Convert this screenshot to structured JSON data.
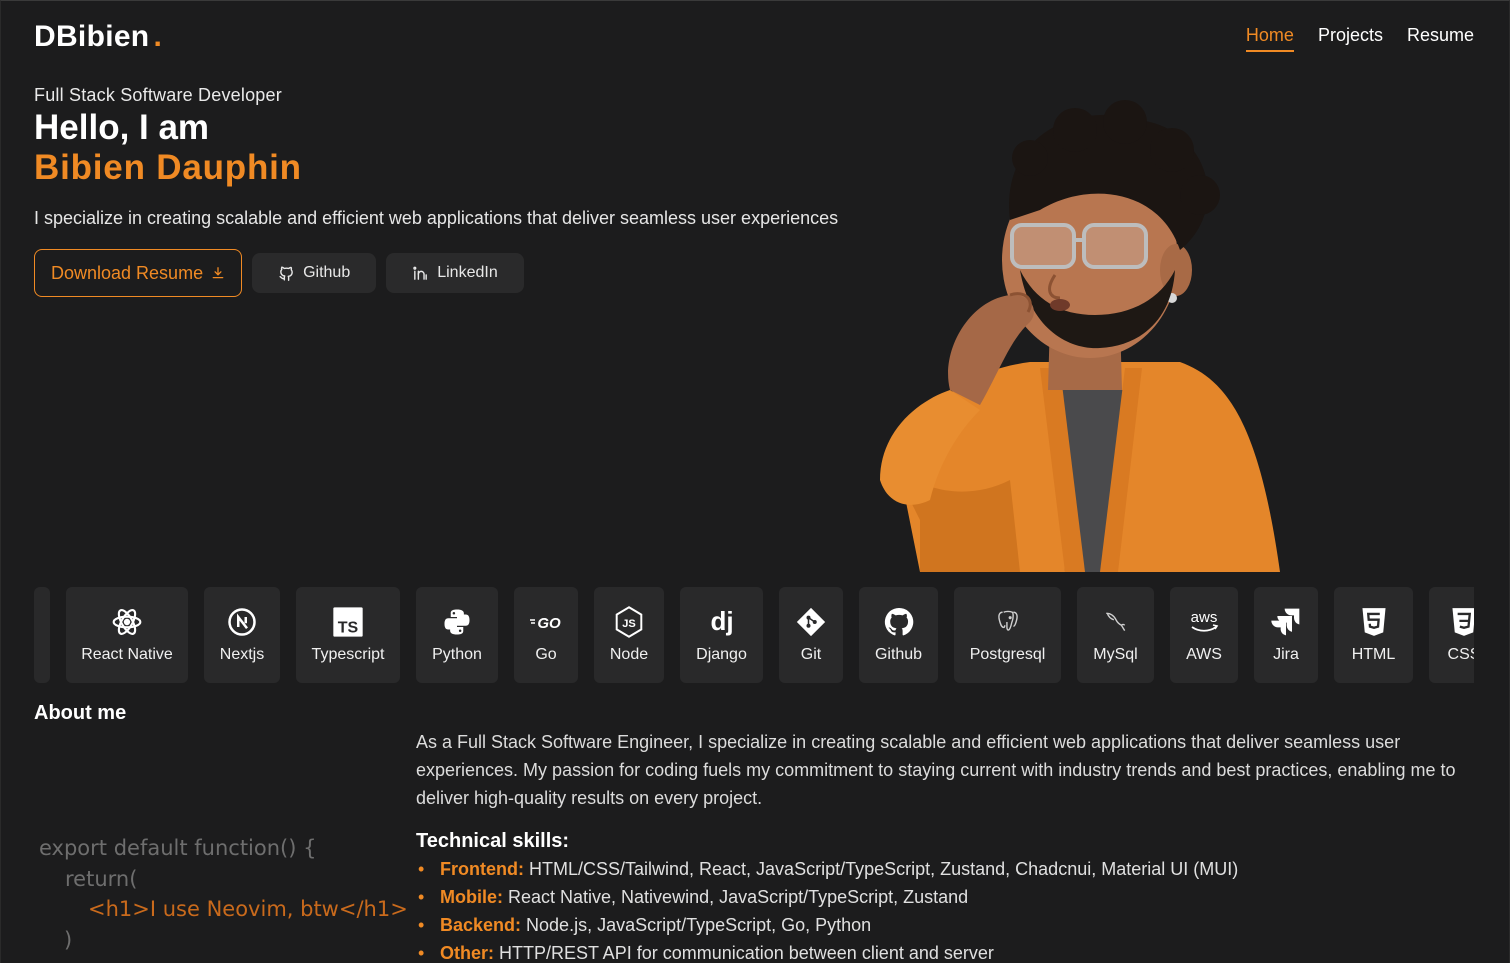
{
  "brand": {
    "name": "DBibien",
    "dot": ".",
    "accent_color": "#f08a24"
  },
  "nav": {
    "items": [
      {
        "label": "Home",
        "active": true
      },
      {
        "label": "Projects",
        "active": false
      },
      {
        "label": "Resume",
        "active": false
      }
    ]
  },
  "hero": {
    "role": "Full Stack Software Developer",
    "greeting": "Hello, I am",
    "name": "Bibien Dauphin",
    "tagline": "I specialize in creating scalable and efficient web applications that deliver seamless user experiences",
    "buttons": {
      "resume": "Download Resume",
      "github": "Github",
      "linkedin": "LinkedIn"
    }
  },
  "skills": [
    {
      "label": "React Native",
      "icon": "react-icon"
    },
    {
      "label": "Nextjs",
      "icon": "nextjs-icon"
    },
    {
      "label": "Typescript",
      "icon": "typescript-icon"
    },
    {
      "label": "Python",
      "icon": "python-icon"
    },
    {
      "label": "Go",
      "icon": "go-icon"
    },
    {
      "label": "Node",
      "icon": "nodejs-icon"
    },
    {
      "label": "Django",
      "icon": "django-icon"
    },
    {
      "label": "Git",
      "icon": "git-icon"
    },
    {
      "label": "Github",
      "icon": "github-icon"
    },
    {
      "label": "Postgresql",
      "icon": "postgresql-icon"
    },
    {
      "label": "MySql",
      "icon": "mysql-icon"
    },
    {
      "label": "AWS",
      "icon": "aws-icon"
    },
    {
      "label": "Jira",
      "icon": "jira-icon"
    },
    {
      "label": "HTML",
      "icon": "html5-icon"
    },
    {
      "label": "CSS",
      "icon": "css3-icon"
    }
  ],
  "about": {
    "title": "About me",
    "paragraph": "As a Full Stack Software Engineer, I specialize in creating scalable and efficient web applications that deliver seamless user experiences. My passion for coding fuels my commitment to staying current with industry trends and best practices, enabling me to deliver high-quality results on every project.",
    "code_lines": [
      "export default function() {",
      "return(",
      "<h1>I use Neovim, btw</h1>",
      ")"
    ],
    "tech_title": "Technical skills:",
    "tech": [
      {
        "key": "Frontend:",
        "value": " HTML/CSS/Tailwind, React, JavaScript/TypeScript, Zustand, Chadcnui, Material UI (MUI)"
      },
      {
        "key": "Mobile:",
        "value": " React Native, Nativewind, JavaScript/TypeScript, Zustand"
      },
      {
        "key": "Backend:",
        "value": " Node.js, JavaScript/TypeScript, Go, Python"
      },
      {
        "key": "Other:",
        "value": " HTTP/REST API for communication between client and server"
      }
    ]
  }
}
